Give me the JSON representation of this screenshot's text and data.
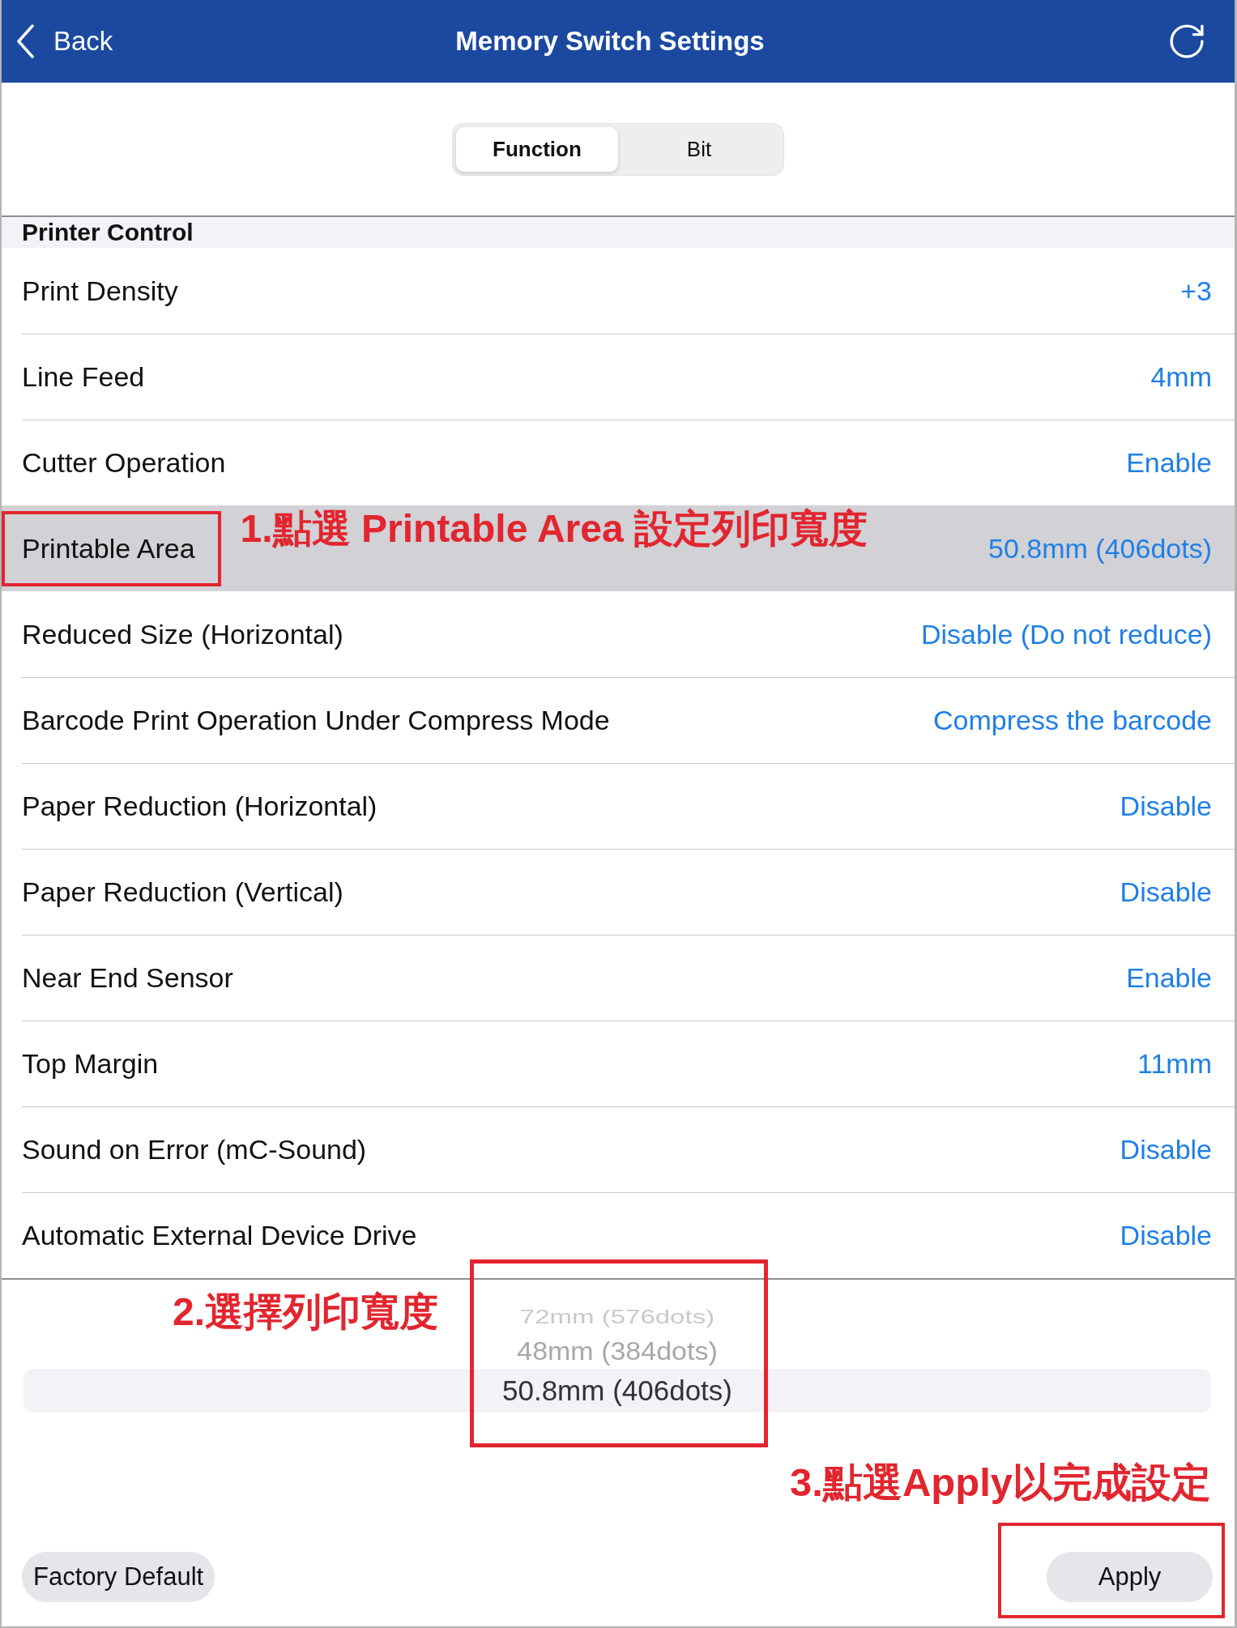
{
  "header": {
    "back": "Back",
    "title": "Memory Switch Settings"
  },
  "segments": [
    {
      "label": "Function",
      "selected": true
    },
    {
      "label": "Bit",
      "selected": false
    }
  ],
  "section": {
    "title": "Printer Control",
    "rows": [
      {
        "label": "Print Density",
        "value": "+3",
        "selected": false,
        "outlined": false
      },
      {
        "label": "Line Feed",
        "value": "4mm",
        "selected": false,
        "outlined": false
      },
      {
        "label": "Cutter Operation",
        "value": "Enable",
        "selected": false,
        "outlined": false
      },
      {
        "label": "Printable Area",
        "value": "50.8mm (406dots)",
        "selected": true,
        "outlined": true,
        "note": "1.點選 Printable Area 設定列印寬度"
      },
      {
        "label": "Reduced Size (Horizontal)",
        "value": "Disable (Do not reduce)",
        "selected": false,
        "outlined": false
      },
      {
        "label": "Barcode Print Operation Under Compress Mode",
        "value": "Compress the barcode",
        "selected": false,
        "outlined": false
      },
      {
        "label": "Paper Reduction (Horizontal)",
        "value": "Disable",
        "selected": false,
        "outlined": false
      },
      {
        "label": "Paper Reduction (Vertical)",
        "value": "Disable",
        "selected": false,
        "outlined": false
      },
      {
        "label": "Near End Sensor",
        "value": "Enable",
        "selected": false,
        "outlined": false
      },
      {
        "label": "Top Margin",
        "value": "11mm",
        "selected": false,
        "outlined": false
      },
      {
        "label": "Sound on Error (mC-Sound)",
        "value": "Disable",
        "selected": false,
        "outlined": false
      },
      {
        "label": "Automatic External Device Drive",
        "value": "Disable",
        "selected": false,
        "outlined": false
      }
    ]
  },
  "picker": {
    "note": "2.選擇列印寬度",
    "outlined": true,
    "options": [
      {
        "label": "72mm (576dots)",
        "selected": false
      },
      {
        "label": "48mm (384dots)",
        "selected": false
      },
      {
        "label": "50.8mm (406dots)",
        "selected": true
      }
    ]
  },
  "footer": {
    "note": "3.點選Apply以完成設定",
    "buttons": [
      {
        "label": "Factory Default",
        "outlined": false
      },
      {
        "label": "Apply",
        "outlined": true
      }
    ]
  }
}
